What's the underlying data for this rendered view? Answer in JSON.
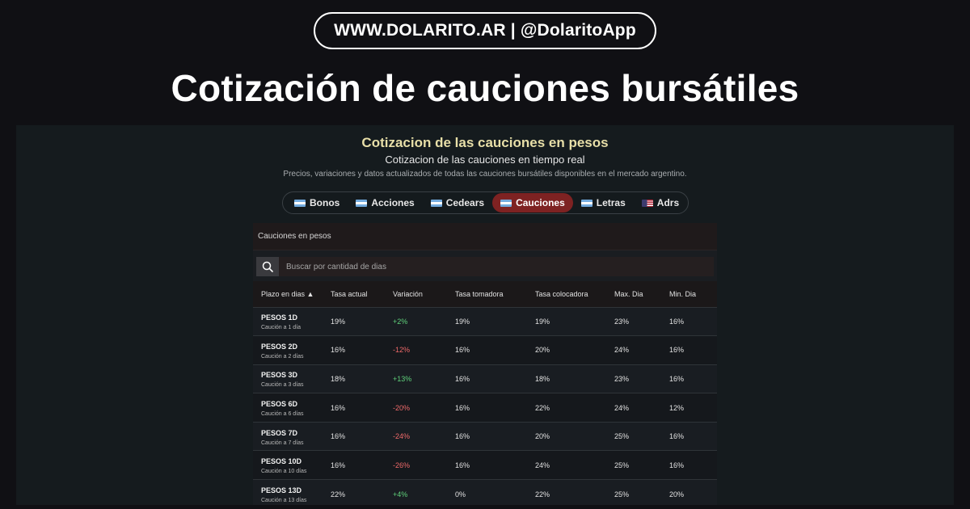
{
  "header": {
    "site": "WWW.DOLARITO.AR | @DolaritoApp",
    "title": "Cotización de cauciones bursátiles"
  },
  "screen": {
    "title": "Cotizacion de las cauciones en pesos",
    "subtitle": "Cotizacion de las cauciones en tiempo real",
    "description": "Precios, variaciones y datos actualizados de todas las cauciones bursátiles disponibles en el mercado argentino.",
    "tabs": [
      {
        "label": "Bonos",
        "flag": "ar-flag-icon",
        "active": false
      },
      {
        "label": "Acciones",
        "flag": "ar-flag-icon",
        "active": false
      },
      {
        "label": "Cedears",
        "flag": "ar-flag-icon",
        "active": false
      },
      {
        "label": "Cauciones",
        "flag": "ar-flag-icon",
        "active": true
      },
      {
        "label": "Letras",
        "flag": "ar-flag-icon",
        "active": false
      },
      {
        "label": "Adrs",
        "flag": "us-flag-icon",
        "active": false
      }
    ],
    "panel_title": "Cauciones en pesos",
    "search": {
      "placeholder": "Buscar por cantidad de dias",
      "value": "",
      "icon": "search-icon"
    },
    "table": {
      "columns": [
        "Plazo en dias ▲",
        "Tasa actual",
        "Variación",
        "Tasa tomadora",
        "Tasa colocadora",
        "Max. Dia",
        "Min. Dia"
      ],
      "rows": [
        {
          "name": "PESOS 1D",
          "sub": "Caución a 1 día",
          "tasa_actual": "19%",
          "variacion": "+2%",
          "trend": "pos",
          "tomadora": "19%",
          "colocadora": "19%",
          "max": "23%",
          "min": "16%"
        },
        {
          "name": "PESOS 2D",
          "sub": "Caución a 2 días",
          "tasa_actual": "16%",
          "variacion": "-12%",
          "trend": "neg",
          "tomadora": "16%",
          "colocadora": "20%",
          "max": "24%",
          "min": "16%"
        },
        {
          "name": "PESOS 3D",
          "sub": "Caución a 3 días",
          "tasa_actual": "18%",
          "variacion": "+13%",
          "trend": "pos",
          "tomadora": "16%",
          "colocadora": "18%",
          "max": "23%",
          "min": "16%"
        },
        {
          "name": "PESOS 6D",
          "sub": "Caución a 6 días",
          "tasa_actual": "16%",
          "variacion": "-20%",
          "trend": "neg",
          "tomadora": "16%",
          "colocadora": "22%",
          "max": "24%",
          "min": "12%"
        },
        {
          "name": "PESOS 7D",
          "sub": "Caución a 7 días",
          "tasa_actual": "16%",
          "variacion": "-24%",
          "trend": "neg",
          "tomadora": "16%",
          "colocadora": "20%",
          "max": "25%",
          "min": "16%"
        },
        {
          "name": "PESOS 10D",
          "sub": "Caución a 10 días",
          "tasa_actual": "16%",
          "variacion": "-26%",
          "trend": "neg",
          "tomadora": "16%",
          "colocadora": "24%",
          "max": "25%",
          "min": "16%"
        },
        {
          "name": "PESOS 13D",
          "sub": "Caución a 13 días",
          "tasa_actual": "22%",
          "variacion": "+4%",
          "trend": "pos",
          "tomadora": "0%",
          "colocadora": "22%",
          "max": "25%",
          "min": "20%"
        }
      ]
    }
  },
  "colors": {
    "accent": "#7e2222",
    "title": "#e8dfa8",
    "positive": "#5fd07a",
    "negative": "#f06a6a",
    "background": "#101014"
  }
}
